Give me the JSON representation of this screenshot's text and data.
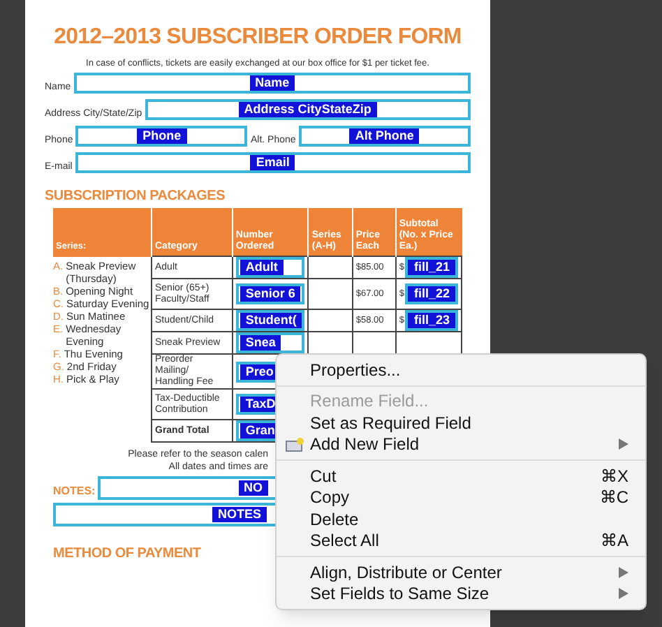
{
  "form": {
    "title": "2012–2013 SUBSCRIBER ORDER FORM",
    "notice": "In case of conflicts, tickets are easily exchanged at our box office for $1 per ticket fee.",
    "contact_rows": [
      [
        {
          "label": "Name",
          "field": "Name"
        }
      ],
      [
        {
          "label": "Address City/State/Zip",
          "field": "Address CityStateZip"
        }
      ],
      [
        {
          "label": "Phone",
          "field": "Phone"
        },
        {
          "label": "Alt. Phone",
          "field": "Alt Phone"
        }
      ],
      [
        {
          "label": "E-mail",
          "field": "Email"
        }
      ]
    ],
    "packages_heading": "SUBSCRIPTION PACKAGES",
    "columns": [
      "Series:",
      "Category",
      "Number Ordered",
      "Series (A-H)",
      "Price Each",
      "Subtotal (No. x Price Ea.)"
    ],
    "series": [
      {
        "letter": "A.",
        "name": "Sneak Preview (Thursday)"
      },
      {
        "letter": "B.",
        "name": "Opening Night"
      },
      {
        "letter": "C.",
        "name": "Saturday Evening"
      },
      {
        "letter": "D.",
        "name": "Sun Matinee"
      },
      {
        "letter": "E.",
        "name": "Wednesday Evening"
      },
      {
        "letter": "F.",
        "name": "Thu Evening"
      },
      {
        "letter": "G.",
        "name": "2nd Friday"
      },
      {
        "letter": "H.",
        "name": "Pick & Play"
      }
    ],
    "rows": [
      {
        "category": "Adult",
        "number_field": "Adult",
        "price": "$85.00",
        "currency": "$",
        "subtotal_field": "fill_21",
        "bold": false
      },
      {
        "category": "Senior (65+) Faculty/Staff",
        "number_field": "Senior 6",
        "price": "$67.00",
        "currency": "$",
        "subtotal_field": "fill_22",
        "bold": false
      },
      {
        "category": "Student/Child",
        "number_field": "Student(",
        "price": "$58.00",
        "currency": "$",
        "subtotal_field": "fill_23",
        "bold": false
      },
      {
        "category": "Sneak Preview",
        "number_field": "Snea",
        "bold": false
      },
      {
        "category": "Preorder Mailing/ Handling Fee",
        "number_field": "Preo",
        "bold": false
      },
      {
        "category": "Tax-Deductible Contribution",
        "number_field": "TaxD",
        "bold": false
      },
      {
        "category": "Grand Total",
        "number_field": "Gran",
        "bold": true
      }
    ],
    "calendar_note": [
      "Please refer to the season calen",
      "All dates and times are"
    ],
    "notes_label": "NOTES:",
    "notes_fields": [
      "NO",
      "NOTES"
    ],
    "payment_heading": "METHOD OF PAYMENT"
  },
  "context_menu": {
    "groups": [
      [
        {
          "label": "Properties...",
          "kind": "plain",
          "disabled": false
        }
      ],
      [
        {
          "label": "Rename Field...",
          "kind": "plain",
          "disabled": true
        },
        {
          "label": "Set as Required Field",
          "kind": "plain",
          "disabled": false
        },
        {
          "label": "Add New Field",
          "kind": "field_icon",
          "disabled": false,
          "submenu": true
        }
      ],
      [
        {
          "label": "Cut",
          "kind": "plain",
          "disabled": false,
          "shortcut": "⌘X"
        },
        {
          "label": "Copy",
          "kind": "plain",
          "disabled": false,
          "shortcut": "⌘C"
        },
        {
          "label": "Delete",
          "kind": "plain",
          "disabled": false
        },
        {
          "label": "Select All",
          "kind": "plain",
          "disabled": false,
          "shortcut": "⌘A"
        }
      ],
      [
        {
          "label": "Align, Distribute or Center",
          "kind": "plain",
          "disabled": false,
          "submenu": true
        },
        {
          "label": "Set Fields to Same Size",
          "kind": "plain",
          "disabled": false,
          "submenu": true
        }
      ]
    ]
  }
}
